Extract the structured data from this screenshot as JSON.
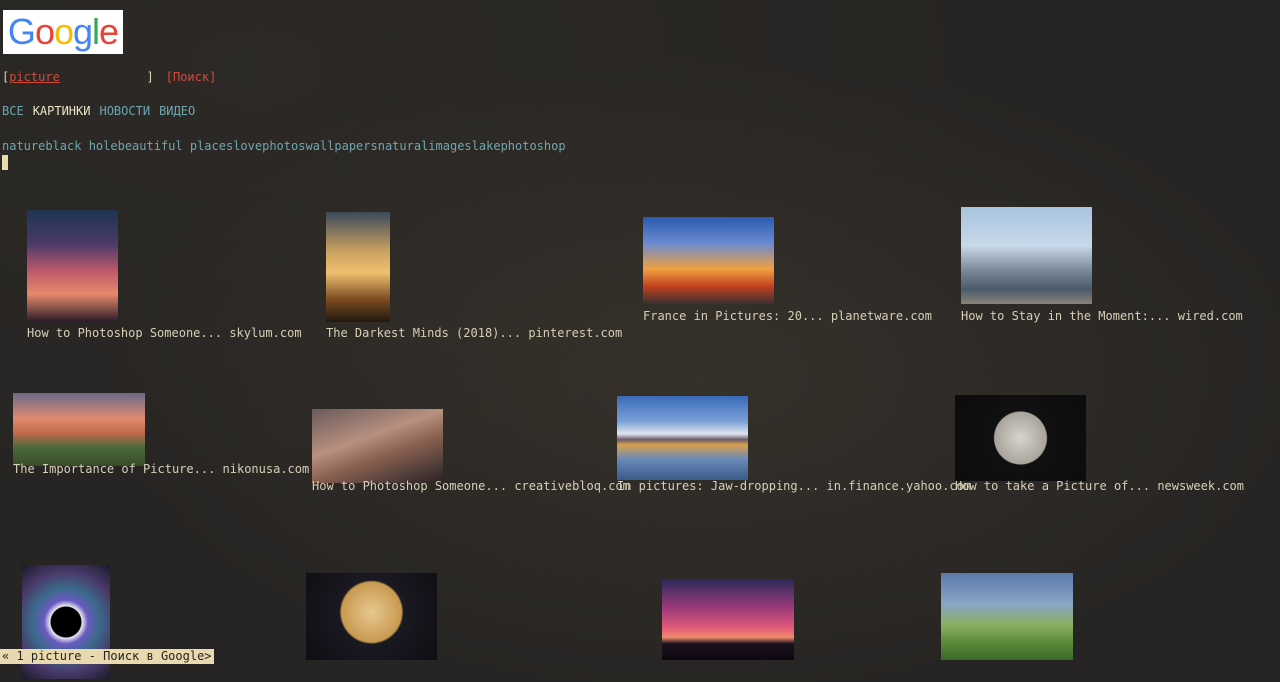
{
  "logo": {
    "letters": [
      "G",
      "o",
      "o",
      "g",
      "l",
      "e"
    ],
    "colors": [
      "#4285F4",
      "#EA4335",
      "#FBBC05",
      "#4285F4",
      "#34A853",
      "#EA4335"
    ]
  },
  "search": {
    "open": "[",
    "value": "picture",
    "close": "]",
    "button": "[Поиск]"
  },
  "tabs": [
    {
      "label": "ВСЕ",
      "active": false
    },
    {
      "label": "КАРТИНКИ",
      "active": true
    },
    {
      "label": "НОВОСТИ",
      "active": false
    },
    {
      "label": "ВИДЕО",
      "active": false
    }
  ],
  "chips": [
    "nature",
    "black hole",
    "beautiful places",
    "love",
    "photos",
    "wallpapers",
    "natural",
    "images",
    "lake",
    "photoshop"
  ],
  "results": [
    {
      "title": "How to Photoshop Someone...",
      "source": "skylum.com",
      "subject": "silhouette-girl-sunset"
    },
    {
      "title": "The Darkest Minds (2018)...",
      "source": "pinterest.com",
      "subject": "couple-sunset"
    },
    {
      "title": "France in Pictures: 20...",
      "source": "planetware.com",
      "subject": "eiffel-tower"
    },
    {
      "title": "How to Stay in the Moment:...",
      "source": "wired.com",
      "subject": "man-on-mountain"
    },
    {
      "title": "The Importance of Picture...",
      "source": "nikonusa.com",
      "subject": "boardwalk-sunset"
    },
    {
      "title": "How to Photoshop Someone...",
      "source": "creativebloq.com",
      "subject": "dinosaur"
    },
    {
      "title": "In pictures: Jaw-dropping...",
      "source": "in.finance.yahoo.com",
      "subject": "mount-fuji-reflection"
    },
    {
      "title": "How to take a Picture of...",
      "source": "newsweek.com",
      "subject": "full-moon-plane"
    },
    {
      "title": "",
      "source": "",
      "subject": "black-hole"
    },
    {
      "title": "",
      "source": "",
      "subject": "man-with-moon"
    },
    {
      "title": "",
      "source": "",
      "subject": "tree-purple-sky"
    },
    {
      "title": "",
      "source": "",
      "subject": "rainbow-field"
    }
  ],
  "status": {
    "text": "« 1 picture - Поиск в Google>"
  },
  "colors": {
    "background": "#272523",
    "text": "#d7cfb6",
    "link": "#6ea6b0",
    "search_red": "#d24b3c",
    "status_bg": "#e8d9ae"
  }
}
